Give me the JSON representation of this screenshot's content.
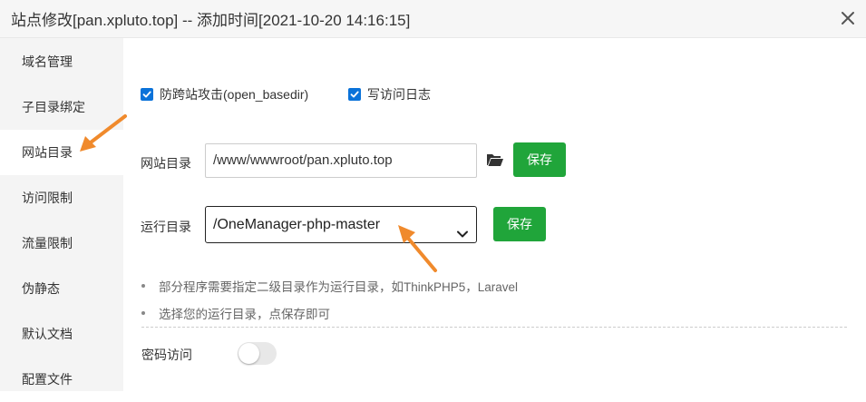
{
  "window": {
    "title": "站点修改[pan.xpluto.top] -- 添加时间[2021-10-20 14:16:15]",
    "close_icon": "close-icon"
  },
  "sidebar": {
    "items": [
      {
        "label": "域名管理",
        "active": false
      },
      {
        "label": "子目录绑定",
        "active": false
      },
      {
        "label": "网站目录",
        "active": true
      },
      {
        "label": "访问限制",
        "active": false
      },
      {
        "label": "流量限制",
        "active": false
      },
      {
        "label": "伪静态",
        "active": false
      },
      {
        "label": "默认文档",
        "active": false
      },
      {
        "label": "配置文件",
        "active": false
      }
    ]
  },
  "main": {
    "checkboxes": [
      {
        "label": "防跨站攻击(open_basedir)",
        "checked": true
      },
      {
        "label": "写访问日志",
        "checked": true
      }
    ],
    "site_dir": {
      "label": "网站目录",
      "value": "/www/wwwroot/pan.xpluto.top",
      "folder_icon": "folder-open-icon",
      "save_label": "保存"
    },
    "run_dir": {
      "label": "运行目录",
      "selected": "/OneManager-php-master",
      "save_label": "保存"
    },
    "tips": [
      "部分程序需要指定二级目录作为运行目录，如ThinkPHP5，Laravel",
      "选择您的运行目录，点保存即可"
    ],
    "password_access": {
      "label": "密码访问",
      "enabled": false
    }
  },
  "colors": {
    "accent_green": "#20a53a",
    "checkbox_blue": "#0a72d9",
    "annotation_orange": "#f08a2c"
  }
}
